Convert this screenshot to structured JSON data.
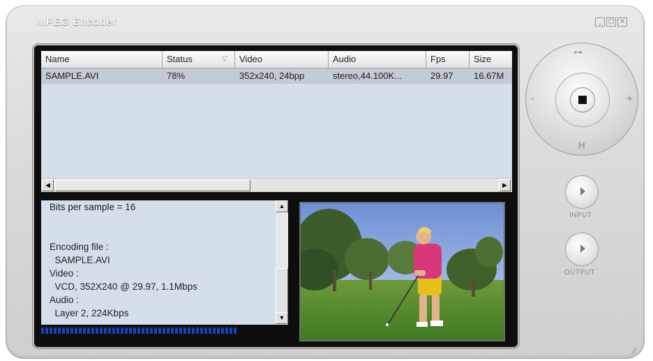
{
  "window": {
    "title": "MPEG Encoder",
    "controls": [
      "minimize",
      "maximize",
      "close"
    ]
  },
  "list": {
    "columns": [
      "Name",
      "Status",
      "Video",
      "Audio",
      "Fps",
      "Size"
    ],
    "rows": [
      {
        "name": "SAMPLE.AVI",
        "status": "78%",
        "video": "352x240, 24bpp",
        "audio": "stereo,44.100K...",
        "fps": "29.97",
        "size": "16.67M"
      }
    ]
  },
  "info": {
    "lines": [
      "Bits per sample = 16",
      "",
      "",
      "Encoding file :",
      "  SAMPLE.AVI",
      "Video :",
      "  VCD, 352X240 @ 29.97, 1.1Mbps",
      "Audio :",
      "  Layer 2, 224Kbps"
    ]
  },
  "progress": {
    "value": 0.78
  },
  "controls": {
    "dial_top_glyph": "⊶",
    "dial_bottom_label": "H",
    "dial_left_label": "-",
    "dial_right_label": "+",
    "input_label": "INPUT",
    "output_label": "OUTPUT"
  },
  "colors": {
    "panel_bg": "#d4dfe9",
    "selected_row": "#c3cbd4",
    "progress": "#1d3fb8",
    "screen_frame": "#0e0e0e"
  },
  "icons": [
    "minimize-icon",
    "maximize-icon",
    "close-icon",
    "sort-icon",
    "scroll-left-icon",
    "scroll-right-icon",
    "scroll-up-icon",
    "scroll-down-icon",
    "stop-icon",
    "play-icon",
    "resize-grip-icon"
  ]
}
